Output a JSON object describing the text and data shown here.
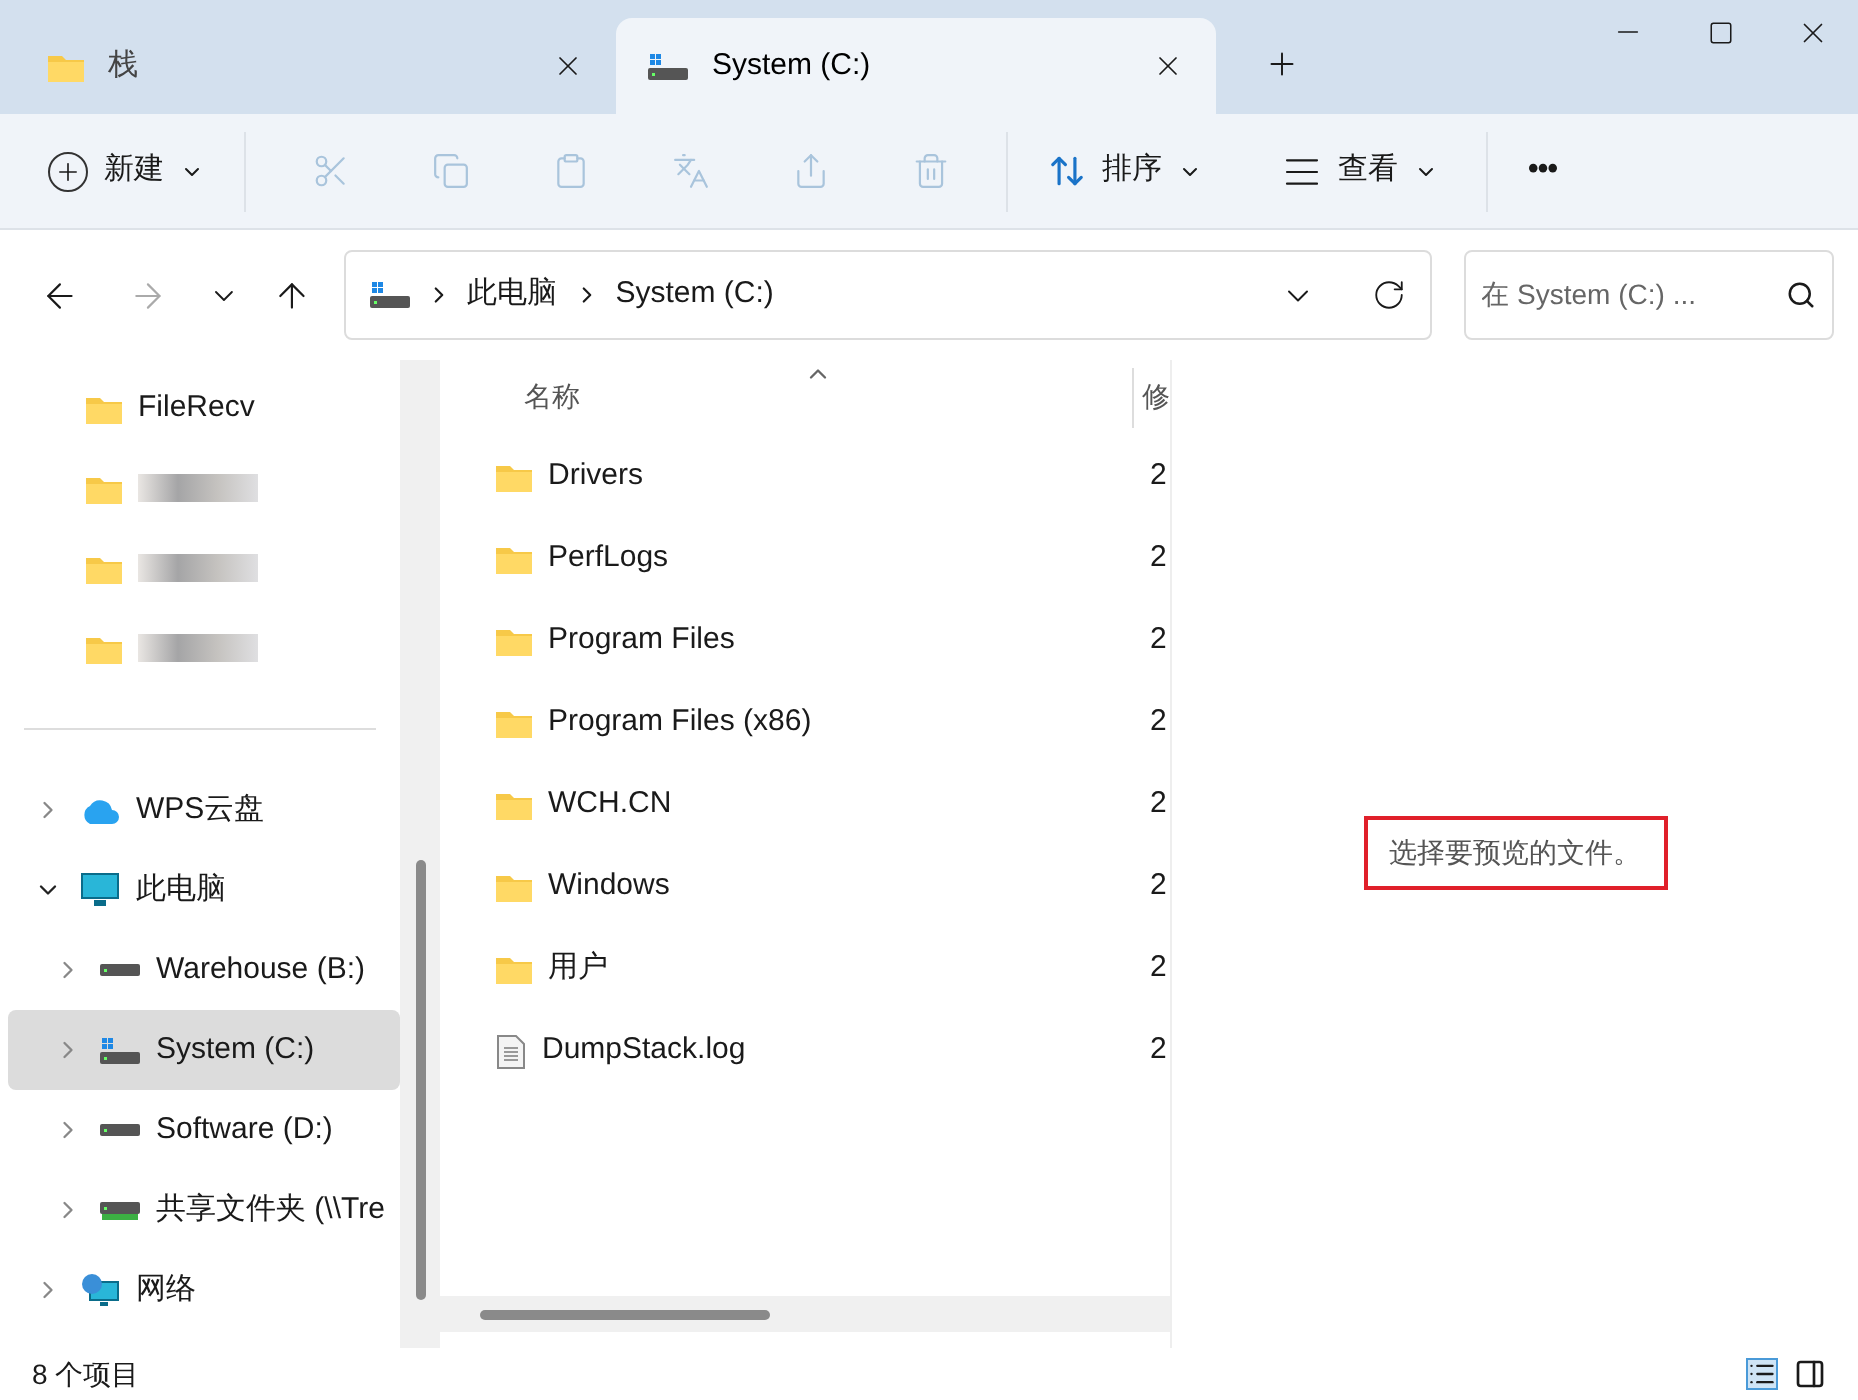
{
  "tabs": [
    {
      "label": "栈",
      "kind": "folder",
      "selected": false
    },
    {
      "label": "System (C:)",
      "kind": "drive",
      "selected": true
    }
  ],
  "toolbar": {
    "new_label": "新建",
    "sort_label": "排序",
    "view_label": "查看",
    "more_label": "•••"
  },
  "address": {
    "crumbs": [
      "此电脑",
      "System (C:)"
    ],
    "search_placeholder": "在 System (C:) ..."
  },
  "quick_access": [
    {
      "label": "FileRecv",
      "kind": "folder",
      "selected": false
    },
    {
      "kind": "blurred",
      "selected": false
    },
    {
      "kind": "blurred",
      "selected": false
    },
    {
      "kind": "blurred",
      "selected": false
    }
  ],
  "tree": [
    {
      "label": "WPS云盘",
      "kind": "cloud",
      "expanded": false,
      "selected": false
    },
    {
      "label": "此电脑",
      "kind": "pc",
      "expanded": true,
      "selected": false,
      "children": [
        {
          "label": "Warehouse (B:)",
          "kind": "drive",
          "expanded": false,
          "selected": false
        },
        {
          "label": "System (C:)",
          "kind": "sysdrive",
          "expanded": false,
          "selected": true
        },
        {
          "label": "Software (D:)",
          "kind": "drive",
          "expanded": false,
          "selected": false
        },
        {
          "label": "共享文件夹 (\\\\Tre",
          "kind": "netdrive",
          "expanded": false,
          "selected": false
        }
      ]
    },
    {
      "label": "网络",
      "kind": "network",
      "expanded": false,
      "selected": false
    }
  ],
  "files": {
    "columns": [
      "名称",
      "修"
    ],
    "rows": [
      {
        "name": "Drivers",
        "kind": "folder",
        "column_2": "2"
      },
      {
        "name": "PerfLogs",
        "kind": "folder",
        "column_2": "2"
      },
      {
        "name": "Program Files",
        "kind": "folder",
        "column_2": "2"
      },
      {
        "name": "Program Files (x86)",
        "kind": "folder",
        "column_2": "2"
      },
      {
        "name": "WCH.CN",
        "kind": "folder",
        "column_2": "2"
      },
      {
        "name": "Windows",
        "kind": "folder",
        "column_2": "2"
      },
      {
        "name": "用户",
        "kind": "folder",
        "column_2": "2"
      },
      {
        "name": "DumpStack.log",
        "kind": "file",
        "column_2": "2"
      }
    ]
  },
  "preview": {
    "message": "选择要预览的文件。",
    "highlighted": true
  },
  "status_bar": {
    "count": "8 个项目"
  }
}
